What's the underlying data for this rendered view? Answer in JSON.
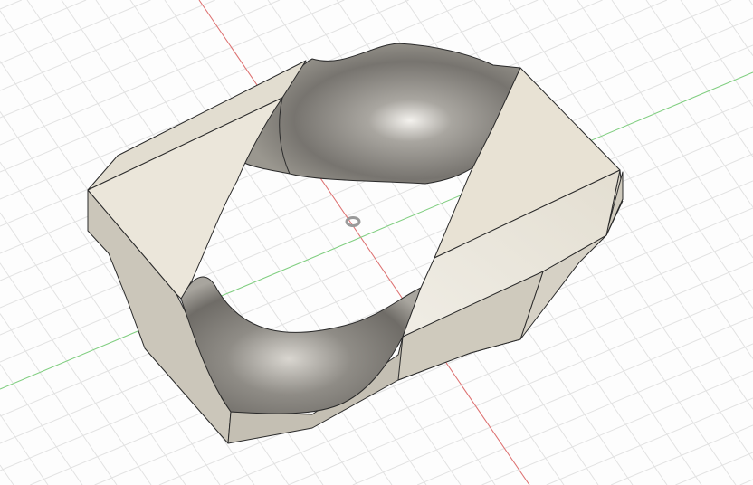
{
  "viewport": {
    "background": "#fdfdfd",
    "grid_color": "#e2e2e2",
    "x_axis_color": "#e07070",
    "y_axis_color": "#7fd07f",
    "face_light": "#ebe6da",
    "face_side": "#cbc6ba",
    "metal": "#8a8883"
  }
}
